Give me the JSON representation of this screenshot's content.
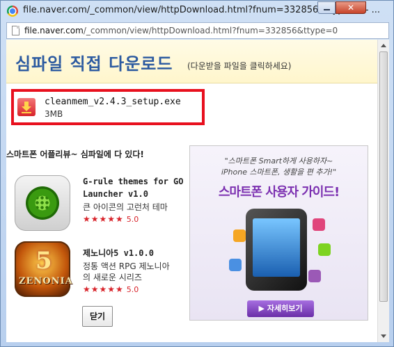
{
  "window": {
    "title": "file.naver.com/_common/view/httpDownload.html?fnum=332856&ttype=0 - ...",
    "close_glyph": "✕"
  },
  "address_bar": {
    "host": "file.naver.com",
    "path": "/_common/view/httpDownload.html?fnum=332856&ttype=0"
  },
  "header": {
    "title": "심파일 직접 다운로드",
    "subtitle": "(다운받을 파일을 클릭하세요)"
  },
  "download": {
    "file_name": "cleanmem_v2.4.3_setup.exe",
    "file_size": "3MB"
  },
  "promo": {
    "title": "스마트폰 어플리뷰~ 심파일에 다 있다!",
    "apps": [
      {
        "name": "G-rule themes for GO Launcher v1.0",
        "desc": "큰 아이콘의 고런처 테마",
        "stars": "★★★★★",
        "rating": "5.0"
      },
      {
        "name": "제노니아5 v1.0.0",
        "desc_line1": "정통 액션 RPG 제노니아",
        "desc_line2": "의 새로운 시리즈",
        "stars": "★★★★★",
        "rating": "5.0",
        "icon_text": "ZENONIA",
        "icon_numeral": "5"
      }
    ]
  },
  "close_button": {
    "label": "닫기"
  },
  "ad": {
    "quote_line1": "\"스마트폰 Smart하게 사용하자~",
    "quote_line2": "iPhone 스마트폰, 생활을 편 추가!\"",
    "headline": "스마트폰 사용자 가이드!",
    "cta": "▶ 자세히보기"
  }
}
